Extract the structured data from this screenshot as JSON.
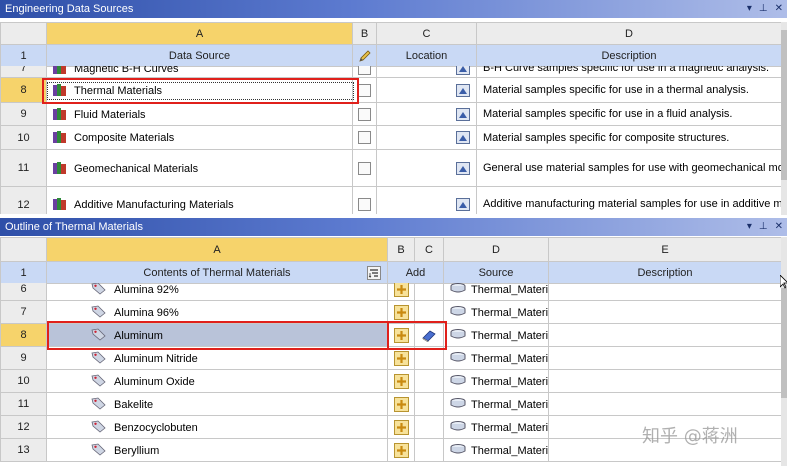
{
  "top_panel": {
    "title": "Engineering Data Sources",
    "columns": [
      "A",
      "B",
      "C",
      "D"
    ],
    "headers": {
      "a": "Data Source",
      "c": "Location",
      "d": "Description"
    },
    "header_row_number": "1",
    "rows": [
      {
        "n": "7",
        "name": "Magnetic B-H Curves",
        "desc": "B-H Curve samples specific for use in a magnetic analysis."
      },
      {
        "n": "8",
        "name": "Thermal Materials",
        "desc": "Material samples specific for use in a thermal analysis."
      },
      {
        "n": "9",
        "name": "Fluid Materials",
        "desc": "Material samples specific for use in a fluid analysis."
      },
      {
        "n": "10",
        "name": "Composite Materials",
        "desc": "Material samples specific for composite structures."
      },
      {
        "n": "11",
        "name": "Geomechanical Materials",
        "desc": "General use material samples for use with geomechanical models."
      },
      {
        "n": "12",
        "name": "Additive Manufacturing Materials",
        "desc": "Additive manufacturing material samples for use in additive manufacturing analyses"
      }
    ]
  },
  "bottom_panel": {
    "title": "Outline of Thermal Materials",
    "columns": [
      "A",
      "B",
      "C",
      "D",
      "E"
    ],
    "headers": {
      "a": "Contents of Thermal Materials",
      "add": "Add",
      "source": "Source",
      "e": "Description"
    },
    "header_row_number": "1",
    "rows": [
      {
        "n": "6",
        "name": "Alumina 92%",
        "source": "Thermal_Materi"
      },
      {
        "n": "7",
        "name": "Alumina 96%",
        "source": "Thermal_Materi"
      },
      {
        "n": "8",
        "name": "Aluminum",
        "source": "Thermal_Materi"
      },
      {
        "n": "9",
        "name": "Aluminum Nitride",
        "source": "Thermal_Materi"
      },
      {
        "n": "10",
        "name": "Aluminum Oxide",
        "source": "Thermal_Materi"
      },
      {
        "n": "11",
        "name": "Bakelite",
        "source": "Thermal_Materi"
      },
      {
        "n": "12",
        "name": "Benzocyclobuten",
        "source": "Thermal_Materi"
      },
      {
        "n": "13",
        "name": "Beryllium",
        "source": "Thermal_Materi"
      }
    ]
  },
  "panel_controls": {
    "dropdown": "▾",
    "pin": "⊥",
    "close": "✕"
  },
  "watermark": "知乎 @蒋洲",
  "colors": {
    "title_blue": "#2e4fa8",
    "selected_header": "#f6d36b",
    "subheader_blue": "#c9d9f5",
    "highlight_red": "#e0201b"
  }
}
